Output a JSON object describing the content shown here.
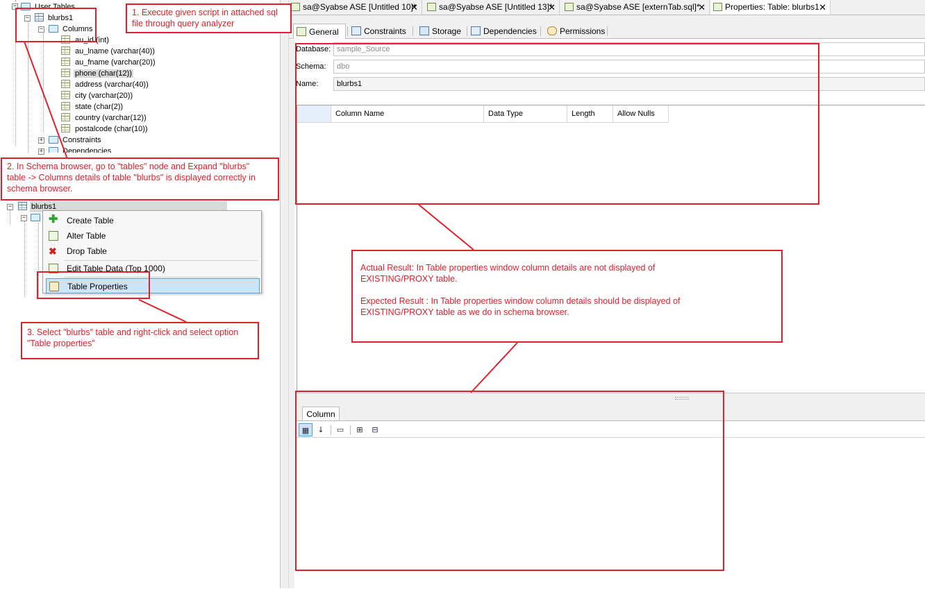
{
  "tree": {
    "user_tables": "User Tables",
    "table1": "blurbs1",
    "columns_folder": "Columns",
    "columns": [
      "au_id (int)",
      "au_lname (varchar(40))",
      "au_fname (varchar(20))",
      "phone (char(12))",
      "address (varchar(40))",
      "city (varchar(20))",
      "state (char(2))",
      "country (varchar(12))",
      "postalcode (char(10))"
    ],
    "constraints": "Constraints",
    "dependencies": "Dependencies",
    "table2": "blurbs1"
  },
  "context_menu": {
    "items": [
      "Create Table",
      "Alter Table",
      "Drop Table",
      "Edit Table Data (Top 1000)",
      "Table Properties"
    ]
  },
  "doc_tabs": [
    {
      "label": "sa@Syabse ASE [Untitled 10]*",
      "close": "✕"
    },
    {
      "label": "sa@Syabse ASE [Untitled 13]*",
      "close": "✕"
    },
    {
      "label": "sa@Syabse ASE [externTab.sql]*",
      "close": "✕"
    },
    {
      "label": "Properties: Table: blurbs1",
      "close": "✕"
    }
  ],
  "sub_tabs": [
    "General",
    "Constraints",
    "Storage",
    "Dependencies",
    "Permissions"
  ],
  "properties": {
    "database_label": "Database:",
    "database_value": "sample_Source",
    "schema_label": "Schema:",
    "schema_value": "dbo",
    "name_label": "Name:",
    "name_value": "blurbs1"
  },
  "grid": {
    "headers": [
      "Column Name",
      "Data Type",
      "Length",
      "Allow Nulls"
    ]
  },
  "lower_panel": {
    "tab": "Column"
  },
  "annotations": {
    "step1": [
      "1. Execute  given script in attached sql",
      "file through query analyzer"
    ],
    "step2": [
      "2. In Schema browser, go to \"tables\" node and Expand \"blurbs\"",
      "table -> Columns details of table \"blurbs\" is displayed correctly in",
      "schema browser."
    ],
    "step3": [
      "3. Select \"blurbs\" table and right-click  and select option",
      "\"Table properties\""
    ],
    "actual": [
      "Actual Result: In Table properties window column details are not displayed of",
      "EXISTING/PROXY table."
    ],
    "expected": [
      "Expected Result :  In Table properties window column details should be displayed of",
      "EXISTING/PROXY table as we do in schema browser."
    ]
  },
  "colors": {
    "annotation_red": "#e0202a",
    "menu_highlight": "#cce4f7",
    "grid_row_header": "#e5eef9"
  }
}
